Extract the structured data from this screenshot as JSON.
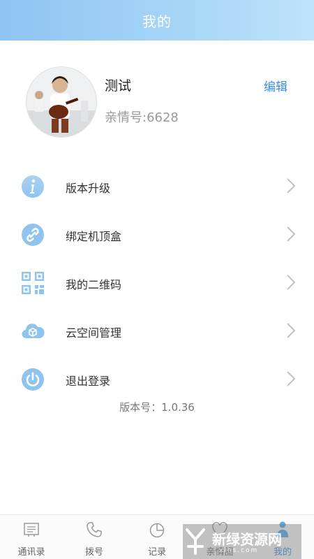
{
  "header": {
    "title": "我的"
  },
  "profile": {
    "name": "测试",
    "id_line": "亲情号:6628",
    "edit_label": "编辑"
  },
  "menu": {
    "items": [
      {
        "label": "版本升级",
        "icon": "info-icon"
      },
      {
        "label": "绑定机顶盒",
        "icon": "link-icon"
      },
      {
        "label": "我的二维码",
        "icon": "qr-code-icon"
      },
      {
        "label": "云空间管理",
        "icon": "cloud-box-icon"
      },
      {
        "label": "退出登录",
        "icon": "power-icon"
      }
    ]
  },
  "version": {
    "text": "版本号：1.0.36"
  },
  "tabbar": {
    "tabs": [
      {
        "label": "通讯录",
        "icon": "contacts-icon"
      },
      {
        "label": "拨号",
        "icon": "phone-icon"
      },
      {
        "label": "记录",
        "icon": "pie-chart-icon"
      },
      {
        "label": "亲情圈",
        "icon": "heart-icon"
      },
      {
        "label": "我的",
        "icon": "person-icon",
        "active": true
      }
    ]
  },
  "watermark": {
    "text": "新绿资源网",
    "sub": "xlhs.com"
  },
  "colors": {
    "header": "#9ccff5",
    "accent": "#3a8ee6",
    "icon": "#8ec4ee"
  }
}
